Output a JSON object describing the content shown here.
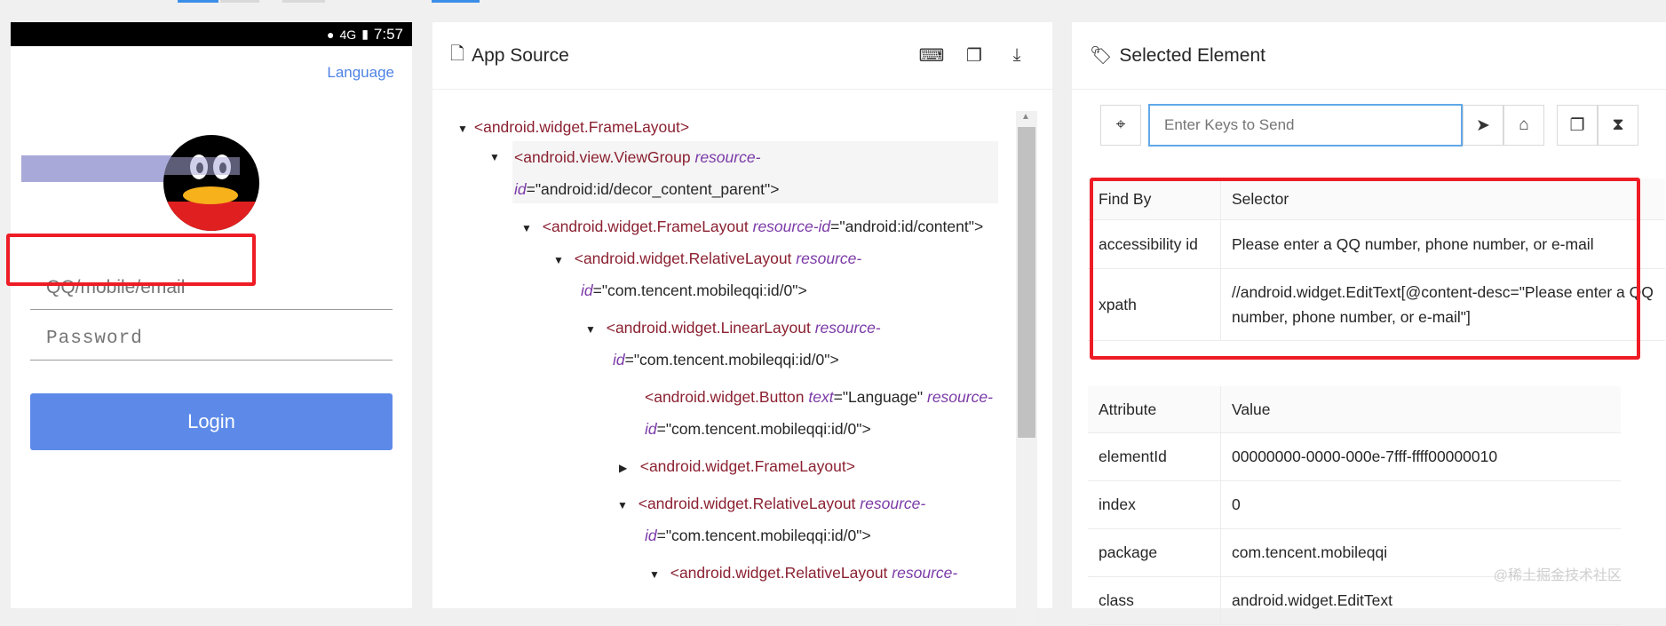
{
  "device": {
    "status": {
      "network": "4G",
      "time": "7:57"
    },
    "language_link": "Language",
    "username_placeholder": "QQ/mobile/email",
    "password_placeholder": "Password",
    "login_button": "Login"
  },
  "source_panel": {
    "title": "App Source",
    "icons": [
      "file-icon",
      "terminal-icon",
      "copy-icon",
      "download-icon"
    ]
  },
  "tree": {
    "n0": {
      "tag": "<android.widget.FrameLayout>"
    },
    "n1": {
      "tag": "<android.view.ViewGroup",
      "attr": "resource-",
      "attr2": "id",
      "eq": "=\"android:id/decor_content_parent\">"
    },
    "n2": {
      "tag": "<android.widget.FrameLayout",
      "attr": "resource-id",
      "eq": "=\"android:id/content\">"
    },
    "n3": {
      "tag": "<android.widget.RelativeLayout",
      "attr": "resource-",
      "attr2": "id",
      "eq": "=\"com.tencent.mobileqqi:id/0\">"
    },
    "n4": {
      "tag": "<android.widget.LinearLayout",
      "attr": "resource-",
      "attr2": "id",
      "eq": "=\"com.tencent.mobileqqi:id/0\">"
    },
    "n5": {
      "tag": "<android.widget.Button",
      "attr_text": "text",
      "text_val": "=\"Language\"",
      "attr": "resource-",
      "attr2": "id",
      "eq": "=\"com.tencent.mobileqqi:id/0\">"
    },
    "n6": {
      "tag": "<android.widget.FrameLayout>"
    },
    "n7": {
      "tag": "<android.widget.RelativeLayout",
      "attr": "resource-",
      "attr2": "id",
      "eq": "=\"com.tencent.mobileqqi:id/0\">"
    },
    "n8": {
      "tag": "<android.widget.RelativeLayout",
      "attr": "resource-"
    }
  },
  "selected_panel": {
    "title": "Selected Element",
    "keys_placeholder": "Enter Keys to Send",
    "selectors_header": {
      "find_by": "Find By",
      "selector": "Selector"
    },
    "selectors": [
      {
        "find_by": "accessibility id",
        "selector": "Please enter a QQ number, phone number, or e-mail"
      },
      {
        "find_by": "xpath",
        "selector": "//android.widget.EditText[@content-desc=\"Please enter a QQ number, phone number, or e-mail\"]"
      }
    ],
    "attributes_header": {
      "attribute": "Attribute",
      "value": "Value"
    },
    "attributes": [
      {
        "attribute": "elementId",
        "value": "00000000-0000-000e-7fff-ffff00000010"
      },
      {
        "attribute": "index",
        "value": "0"
      },
      {
        "attribute": "package",
        "value": "com.tencent.mobileqqi"
      },
      {
        "attribute": "class",
        "value": "android.widget.EditText"
      }
    ]
  },
  "watermark": "@稀土掘金技术社区",
  "colors": {
    "accent": "#5d8ae8",
    "highlight_box": "#ee1c25",
    "tag": "#8b2131",
    "attr": "#7b3aa7"
  }
}
